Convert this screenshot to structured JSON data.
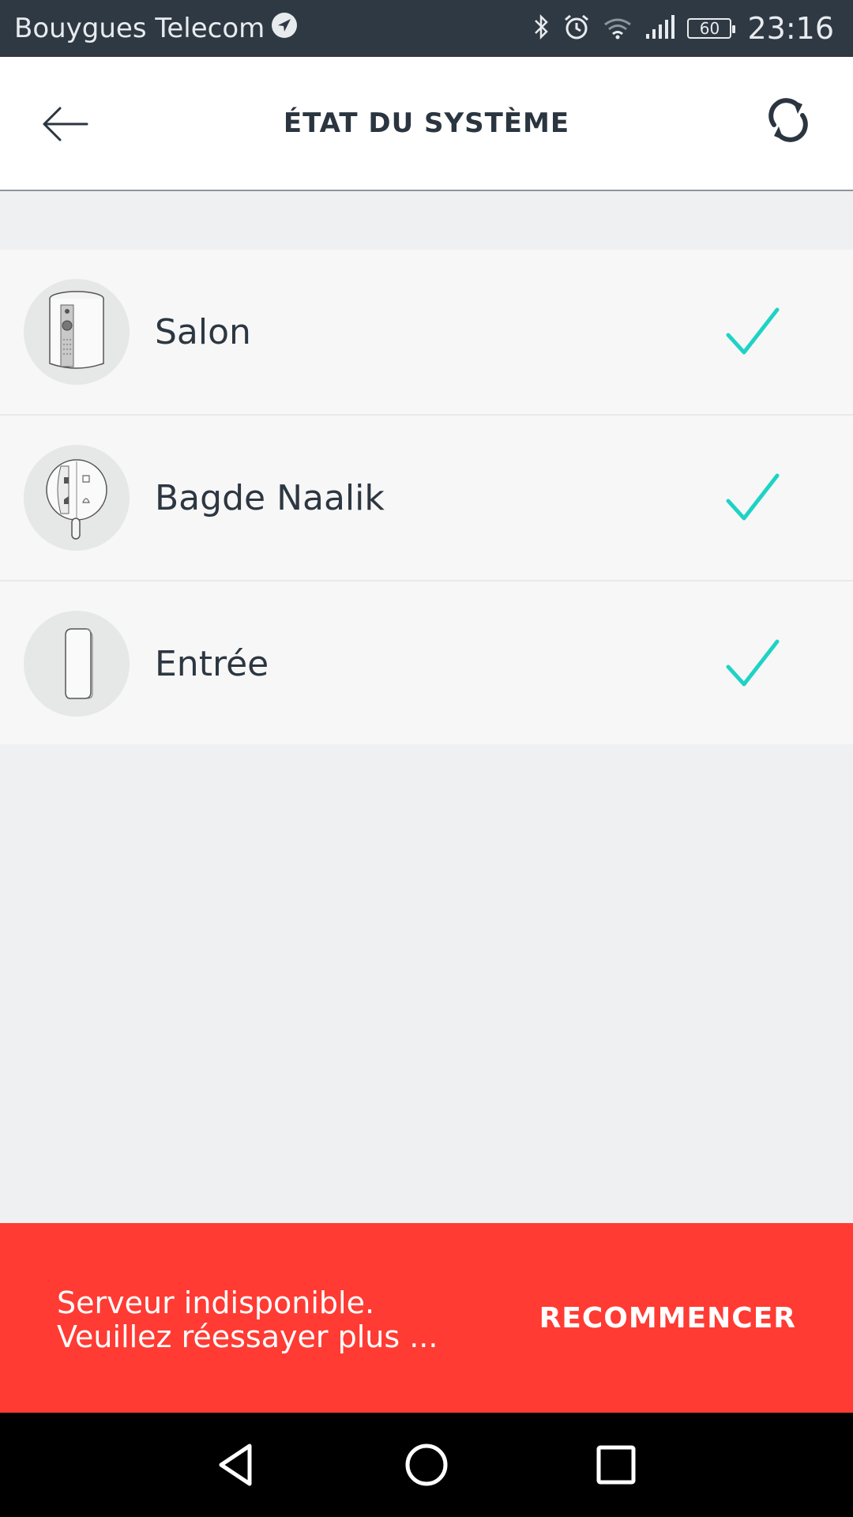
{
  "status_bar": {
    "carrier": "Bouygues Telecom",
    "battery": "60",
    "time": "23:16"
  },
  "header": {
    "title": "ÉTAT DU SYSTÈME",
    "back_icon": "arrow-left-icon",
    "refresh_icon": "refresh-icon"
  },
  "devices": [
    {
      "name": "Salon",
      "icon": "camera-device-icon",
      "status": "ok"
    },
    {
      "name": "Bagde Naalik",
      "icon": "key-fob-badge-icon",
      "status": "ok"
    },
    {
      "name": "Entrée",
      "icon": "door-sensor-icon",
      "status": "ok"
    }
  ],
  "snackbar": {
    "message_line1": "Serveur indisponible.",
    "message_line2": "Veuillez réessayer plus ...",
    "action": "RECOMMENCER"
  },
  "colors": {
    "status_bar": "#2f3943",
    "check": "#1ed3c5",
    "snackbar": "#ff3b33",
    "text_dark": "#2d3742"
  }
}
